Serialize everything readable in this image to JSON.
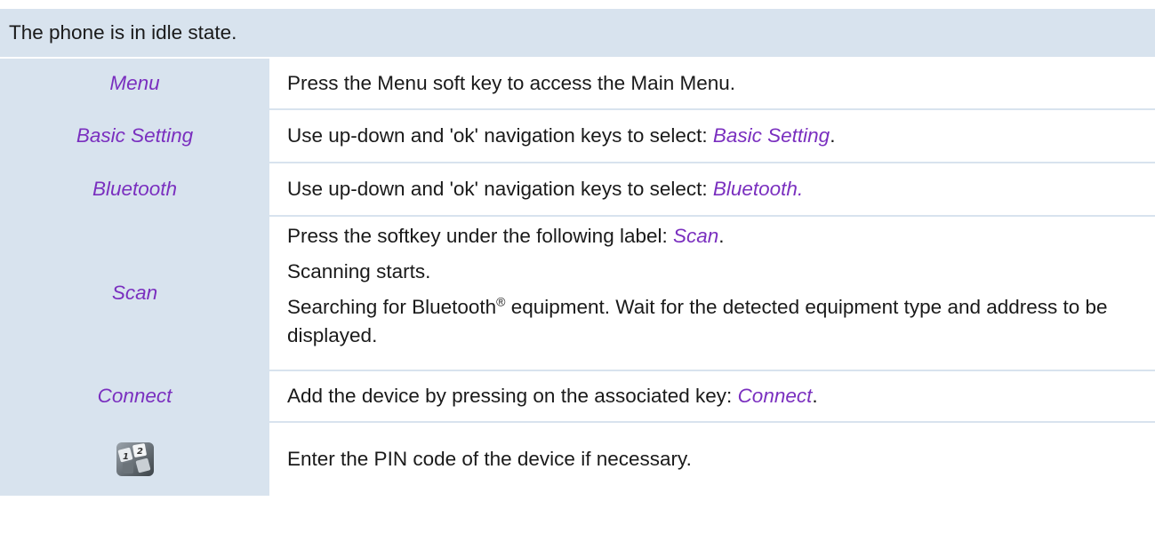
{
  "header": {
    "text": "The phone is in idle state."
  },
  "rows": [
    {
      "label": "Menu",
      "text": "Press the Menu soft key to access the Main Menu."
    },
    {
      "label": "Basic Setting",
      "prefix": "Use up-down and 'ok' navigation keys to select: ",
      "emph": "Basic Setting",
      "suffix": "."
    },
    {
      "label": "Bluetooth",
      "prefix": "Use up-down and 'ok' navigation keys to select: ",
      "emph": "Bluetooth.",
      "suffix": ""
    },
    {
      "label": "Scan",
      "line1_prefix": "Press the softkey under the following label: ",
      "line1_emph": "Scan",
      "line1_suffix": ".",
      "line2": "Scanning starts.",
      "line3_prefix": "Searching for Bluetooth",
      "line3_sup": "®",
      "line3_suffix": " equipment. Wait for the detected equipment type and address to be displayed."
    },
    {
      "label": "Connect",
      "prefix": "Add the device by pressing on the associated key: ",
      "emph": "Connect",
      "suffix": "."
    },
    {
      "icon": "keypad-icon",
      "text": "Enter the PIN code of the device if necessary."
    }
  ],
  "colors": {
    "band": "#d8e3ee",
    "accent": "#7a2fbf",
    "text": "#1a1a1a"
  }
}
